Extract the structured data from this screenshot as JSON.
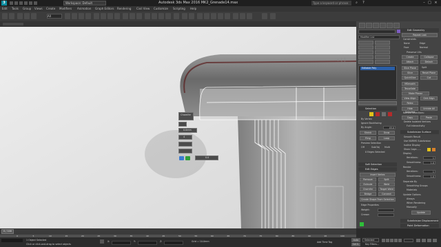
{
  "titlebar": {
    "workspace": "Workspace: Default",
    "app_title": "Autodesk 3ds Max 2016     MK2_Grenade14.max",
    "search_placeholder": "Type a keyword or phrase"
  },
  "menus": [
    "Edit",
    "Tools",
    "Group",
    "Views",
    "Create",
    "Modifiers",
    "Animation",
    "Graph Editors",
    "Rendering",
    "Civil View",
    "Customize",
    "Scripting",
    "Help"
  ],
  "toolbar": {
    "selection_filter": "All"
  },
  "caddy": {
    "title": "Chamfer",
    "value1": "0.0mm",
    "value2": "4",
    "value3": "0.0"
  },
  "command_panel": {
    "object_name": "Edit Geometry",
    "modifier_list": "Modifier List",
    "stack_item": "Editable Poly",
    "selection": {
      "header": "Selection",
      "by_vertex": "By Vertex",
      "ignore_backfacing": "Ignore Backfacing",
      "by_angle": "By Angle:",
      "angle": "45.0",
      "shrink": "Shrink",
      "grow": "Grow",
      "ring": "Ring",
      "loop": "Loop",
      "preview": "Preview Selection",
      "off": "Off",
      "subobj": "SubObj",
      "multi": "Multi",
      "status": "0 Edges Selected"
    },
    "soft_selection": "Soft Selection",
    "edit_edges": {
      "header": "Edit Edges",
      "insert_vertex": "Insert Vertex",
      "remove": "Remove",
      "split": "Split",
      "extrude": "Extrude",
      "weld": "Weld",
      "chamfer": "Chamfer",
      "target_weld": "Target Weld",
      "bridge": "Bridge",
      "connect": "Connect",
      "create_shape": "Create Shape From Selection",
      "edge_properties": "Edge Properties",
      "weight": "Weight:",
      "crease": "Crease:"
    },
    "right_col": {
      "edit_geometry": "Edit Geometry",
      "repeat_last": "Repeat Last",
      "constraints": "Constraints",
      "none": "None",
      "edge": "Edge",
      "face": "Face",
      "normal": "Normal",
      "preserve_uvs": "Preserve UVs",
      "create": "Create",
      "collapse": "Collapse",
      "attach": "Attach",
      "detach": "Detach",
      "slice_plane": "Slice Plane",
      "split": "Split",
      "slice": "Slice",
      "reset_plane": "Reset Plane",
      "quickslice": "QuickSlice",
      "cut": "Cut",
      "msmooth": "MSmooth",
      "tessellate": "Tessellate",
      "make_planar": "Make Planar",
      "view_align": "View Align",
      "grid_align": "Grid Align",
      "relax": "Relax",
      "hide_selected": "Hide Selected",
      "unhide_all": "Unhide All",
      "named_selections": "Named Selections:",
      "copy": "Copy",
      "paste": "Paste",
      "delete_isolated": "Delete Isolated Vertices",
      "full_interactivity": "Full Interactivity",
      "subdivision_surface": "Subdivision Surface",
      "smooth_result": "Smooth Result",
      "use_nurms": "Use NURMS Subdivision",
      "isoline_display": "Isoline Display",
      "show_cage": "Show Cage......",
      "display": "Display",
      "iterations": "Iterations:",
      "iterations_val": "1",
      "smoothness": "Smoothness:",
      "smoothness_val": "1.0",
      "render": "Render",
      "separate_by": "Separate By",
      "smoothing_groups": "Smoothing Groups",
      "materials": "Materials",
      "update_options": "Update Options",
      "always": "Always",
      "when_rendering": "When Rendering",
      "manually": "Manually",
      "update": "Update",
      "subdivision_displacement": "Subdivision Displacement",
      "paint_deformation": "Paint Deformation"
    }
  },
  "timeline": {
    "frame": "0 / 100",
    "ticks": [
      "0",
      "5",
      "10",
      "15",
      "20",
      "25",
      "30",
      "35",
      "40",
      "45",
      "50",
      "55",
      "60",
      "65",
      "70",
      "75",
      "80",
      "85",
      "90",
      "95",
      "100"
    ]
  },
  "status": {
    "selected": "1 Object Selected",
    "prompt": "Click or click-and-drag to select objects",
    "x": "X:",
    "y": "Y:",
    "z": "Z:",
    "grid": "Grid = 10.0mm",
    "add_time_tag": "Add Time Tag",
    "auto": "Auto",
    "selected_btn": "Selected",
    "set_key": "Set K.",
    "key_filters": "Key Filters..."
  },
  "colors": {
    "accent_teal": "#0e8fa3",
    "selection_yellow": "#e2c21a",
    "stack_blue": "#2a5fa8"
  }
}
